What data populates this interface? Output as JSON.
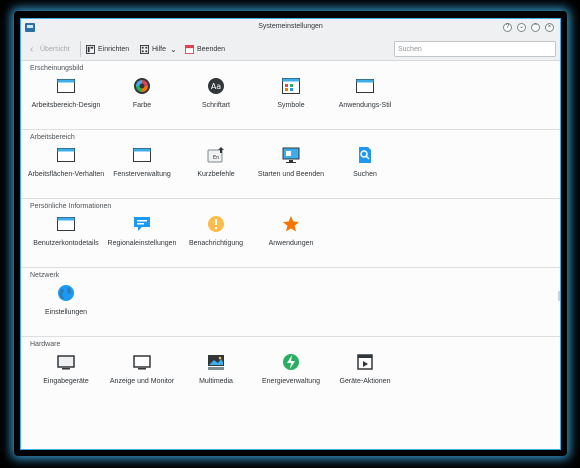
{
  "window": {
    "title": "Systemeinstellungen"
  },
  "toolbar": {
    "back_label": "Übersicht",
    "configure_label": "Einrichten",
    "help_label": "Hilfe",
    "quit_label": "Beenden",
    "search_placeholder": "Suchen"
  },
  "sections": [
    {
      "title": "Erscheinungsbild",
      "items": [
        {
          "label": "Arbeitsbereich-Design",
          "icon": "window-icon"
        },
        {
          "label": "Farbe",
          "icon": "color-wheel-icon"
        },
        {
          "label": "Schriftart",
          "icon": "font-icon"
        },
        {
          "label": "Symbole",
          "icon": "icons-icon"
        },
        {
          "label": "Anwendungs-Stil",
          "icon": "window-icon"
        }
      ]
    },
    {
      "title": "Arbeitsbereich",
      "items": [
        {
          "label": "Arbeitsflächen-Verhalten",
          "icon": "window-icon"
        },
        {
          "label": "Fensterverwaltung",
          "icon": "window-icon"
        },
        {
          "label": "Kurzbefehle",
          "icon": "keyboard-icon"
        },
        {
          "label": "Starten und Beenden",
          "icon": "monitor-icon"
        },
        {
          "label": "Suchen",
          "icon": "search-doc-icon"
        }
      ]
    },
    {
      "title": "Persönliche Informationen",
      "items": [
        {
          "label": "Benutzerkontodetails",
          "icon": "window-icon"
        },
        {
          "label": "Regionaleinstellungen",
          "icon": "chat-icon"
        },
        {
          "label": "Benachrichtigung",
          "icon": "warning-icon"
        },
        {
          "label": "Anwendungen",
          "icon": "star-icon"
        }
      ]
    },
    {
      "title": "Netzwerk",
      "items": [
        {
          "label": "Einstellungen",
          "icon": "globe-icon"
        }
      ]
    },
    {
      "title": "Hardware",
      "items": [
        {
          "label": "Eingabegeräte",
          "icon": "display-icon"
        },
        {
          "label": "Anzeige und Monitor",
          "icon": "display-icon"
        },
        {
          "label": "Multimedia",
          "icon": "media-icon"
        },
        {
          "label": "Energieverwaltung",
          "icon": "power-icon"
        },
        {
          "label": "Geräte-Aktionen",
          "icon": "device-icon"
        }
      ]
    }
  ]
}
